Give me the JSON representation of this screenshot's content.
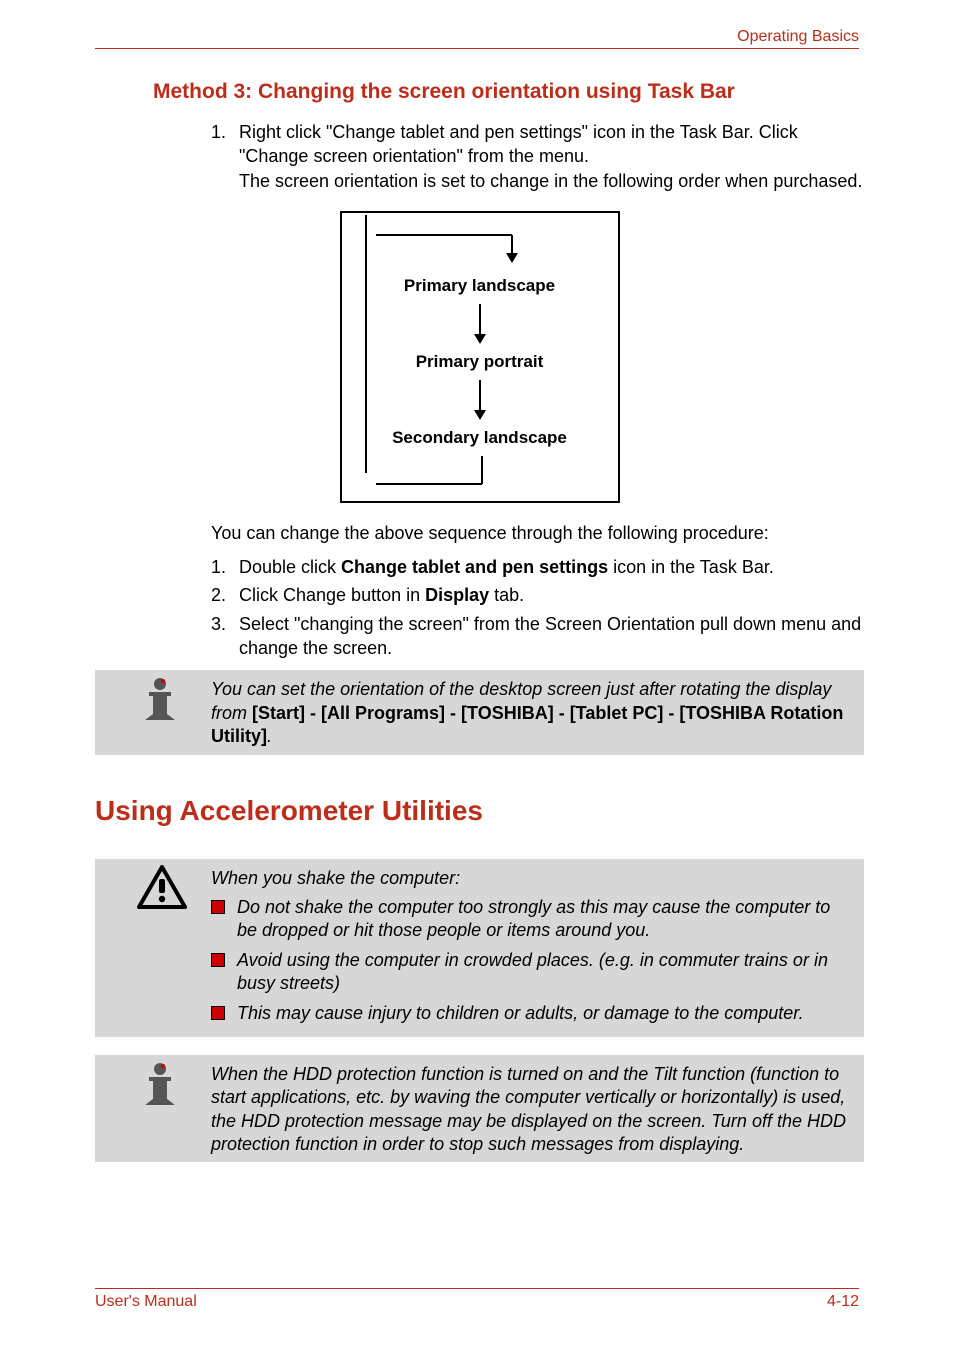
{
  "header": {
    "right": "Operating Basics"
  },
  "section": {
    "method3_heading": "Method 3: Changing the screen orientation using Task Bar",
    "step1_num": "1.",
    "step1_text": "Right click \"Change tablet and pen settings\" icon in the Task Bar. Click \"Change screen orientation\" from the menu.\nThe screen orientation is set to change in the following order when purchased.",
    "diagram": {
      "l1": "Primary landscape",
      "l2": "Primary portrait",
      "l3": "Secondary landscape"
    },
    "para_after_diagram": "You can change the above sequence through the following procedure:",
    "sub_steps": [
      {
        "num": "1.",
        "pre": "Double click ",
        "bold": "Change tablet and pen settings",
        "post": " icon in the Task Bar."
      },
      {
        "num": "2.",
        "pre": "Click Change button in ",
        "bold": "Display",
        "post": " tab."
      },
      {
        "num": "3.",
        "pre": "Select \"changing the screen\" from the Screen Orientation pull down menu and change the screen.",
        "bold": "",
        "post": ""
      }
    ],
    "info1_pre": "You can set the orientation of the desktop screen just after rotating the display from ",
    "info1_bold": "[Start] - [All Programs] - [TOSHIBA] - [Tablet PC] - [TOSHIBA Rotation Utility]",
    "info1_post": "."
  },
  "h1": "Using Accelerometer Utilities",
  "warn": {
    "lead": "When you shake the computer:",
    "bullets": [
      "Do not shake the computer too strongly as this may cause the computer to be dropped or hit those people or items around you.",
      "Avoid using the computer in crowded places. (e.g. in commuter trains or in busy streets)",
      "This may cause injury to children or adults, or damage to the computer."
    ]
  },
  "info2": "When the HDD protection function is turned on and the Tilt function (function to start applications, etc. by waving the computer vertically or horizontally) is used, the HDD protection message may be displayed on the screen. Turn off the HDD protection function in order to stop such messages from displaying.",
  "footer": {
    "left": "User's Manual",
    "right": "4-12"
  }
}
